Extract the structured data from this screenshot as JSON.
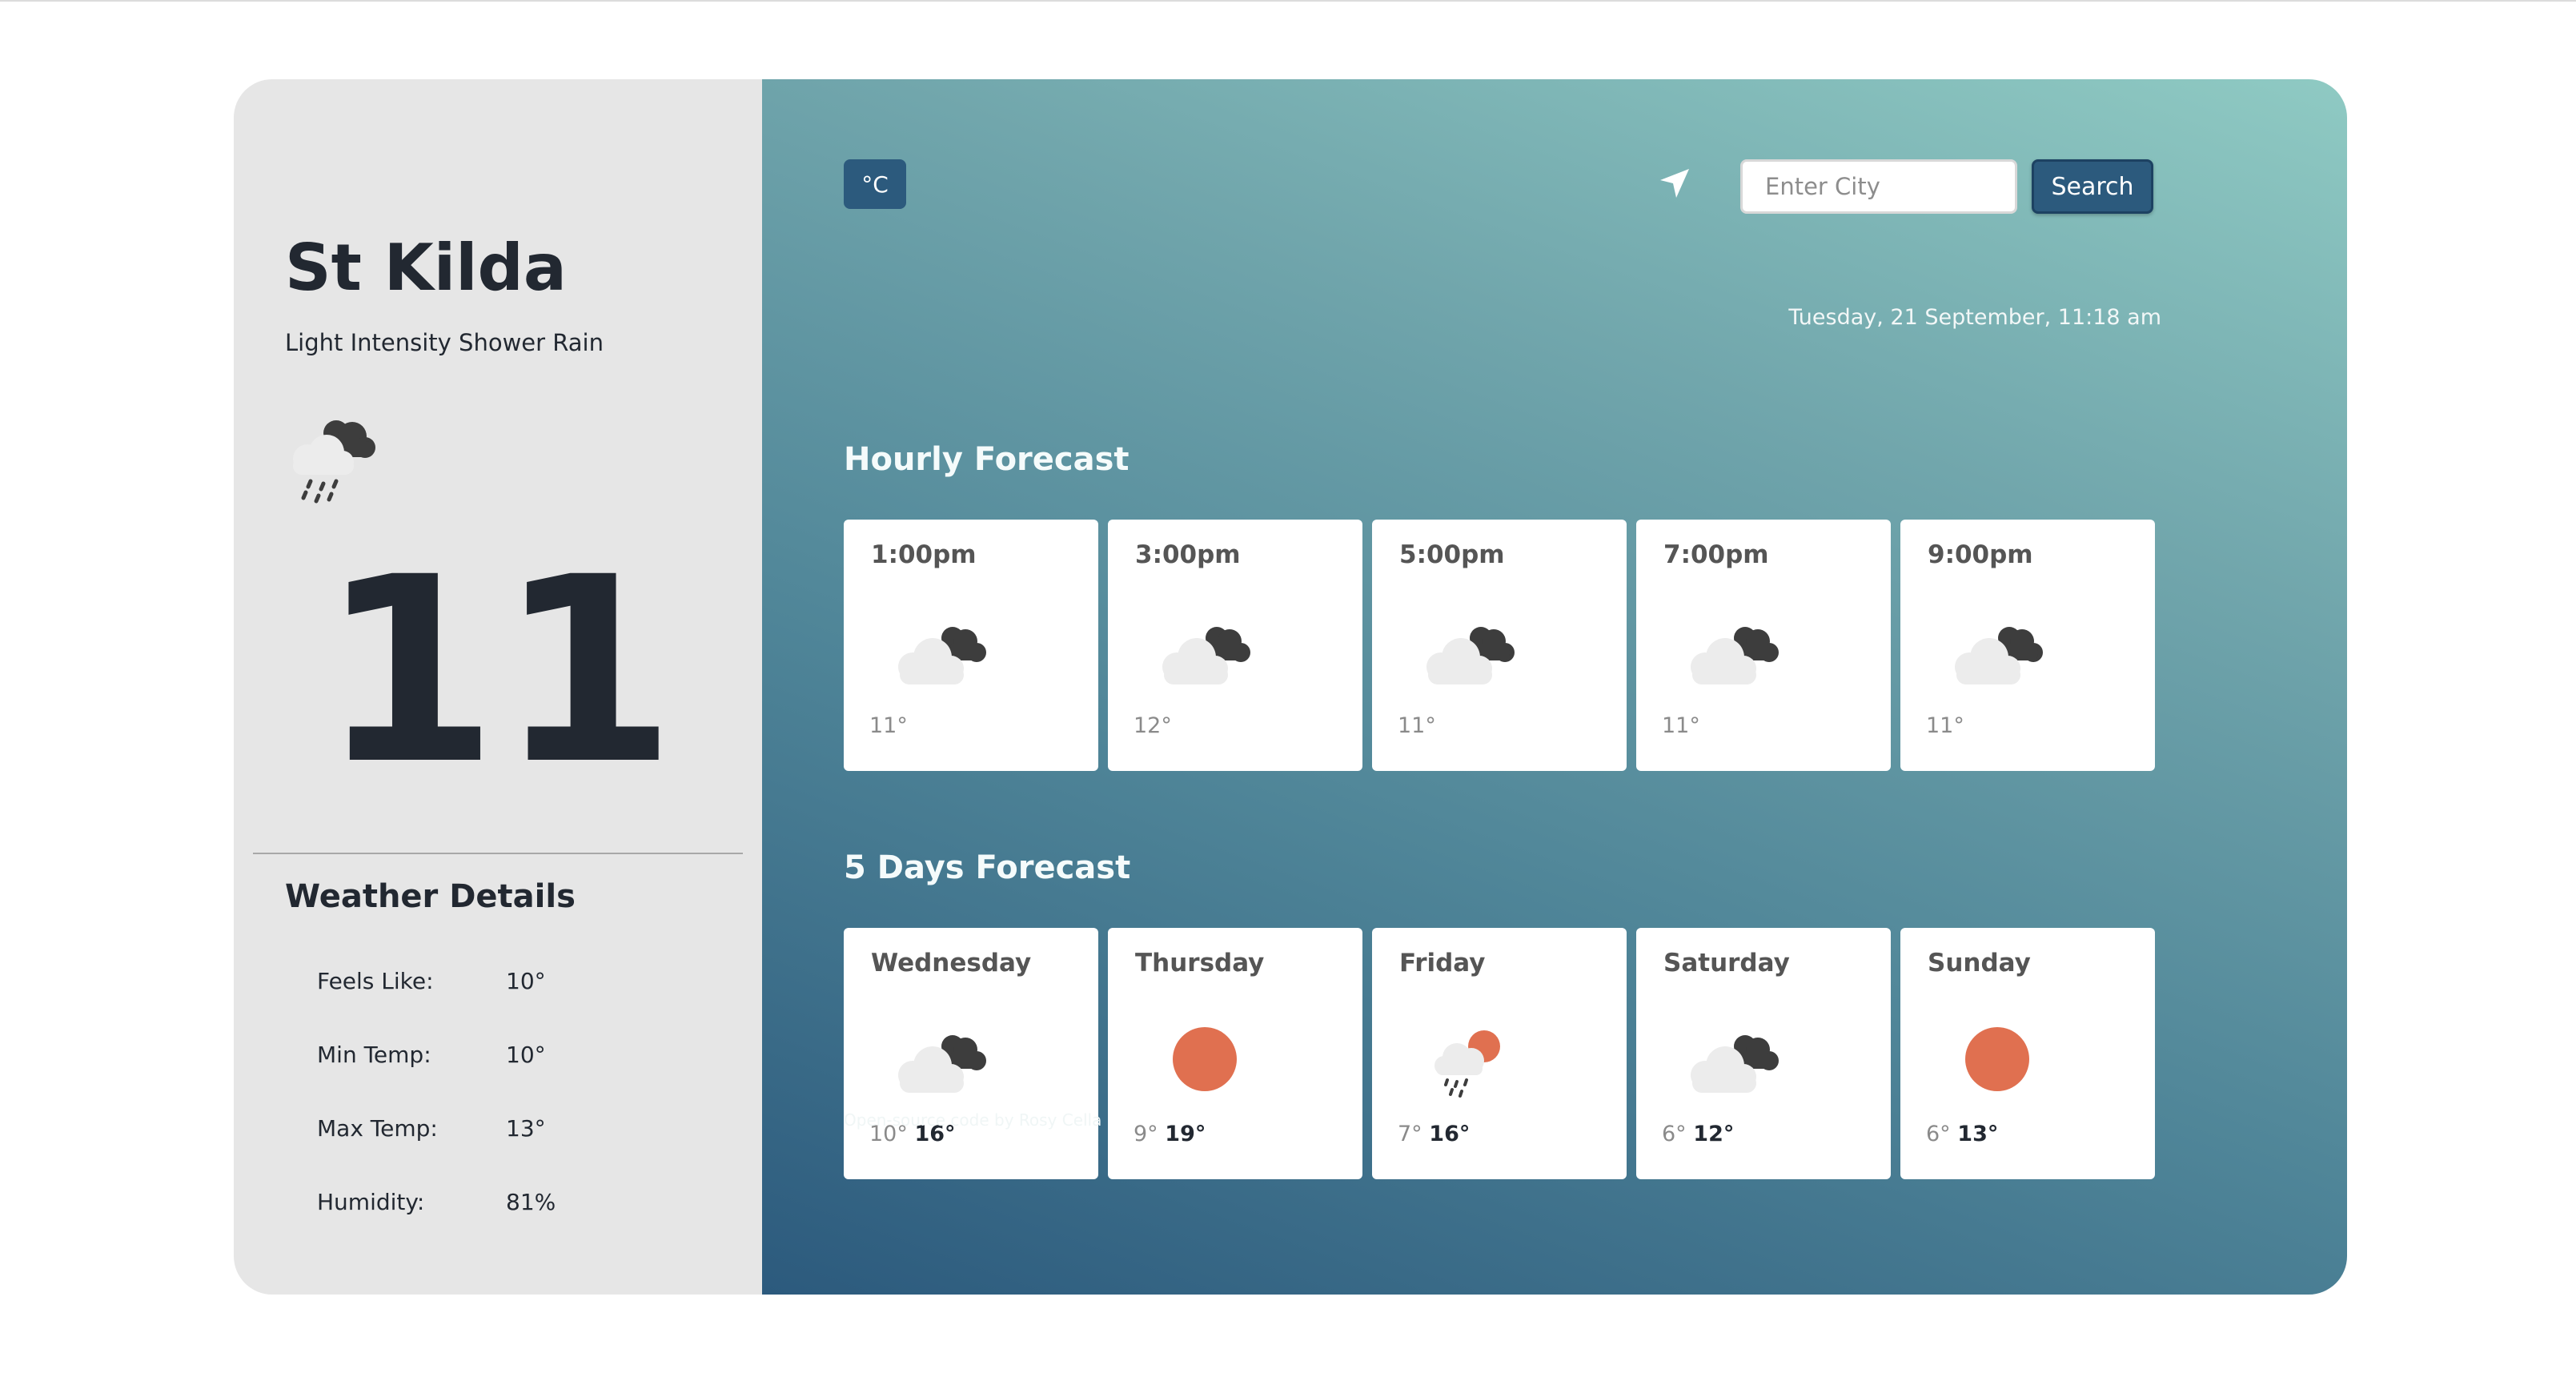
{
  "current": {
    "city": "St Kilda",
    "description": "Light Intensity Shower Rain",
    "icon": "shower-rain-icon",
    "temperature": "11"
  },
  "details": {
    "title": "Weather Details",
    "rows": [
      {
        "label": "Feels Like:",
        "value": "10°"
      },
      {
        "label": "Min Temp:",
        "value": "10°"
      },
      {
        "label": "Max Temp:",
        "value": "13°"
      },
      {
        "label": "Humidity:",
        "value": "81%"
      }
    ]
  },
  "toolbar": {
    "unit_label": "°C",
    "location_icon": "location-arrow-icon",
    "search_placeholder": "Enter City",
    "search_label": "Search",
    "datetime": "Tuesday, 21 September, 11:18 am"
  },
  "hourly": {
    "title": "Hourly Forecast",
    "items": [
      {
        "time": "1:00pm",
        "icon": "broken-clouds-icon",
        "temp": "11°"
      },
      {
        "time": "3:00pm",
        "icon": "broken-clouds-icon",
        "temp": "12°"
      },
      {
        "time": "5:00pm",
        "icon": "broken-clouds-icon",
        "temp": "11°"
      },
      {
        "time": "7:00pm",
        "icon": "broken-clouds-icon",
        "temp": "11°"
      },
      {
        "time": "9:00pm",
        "icon": "broken-clouds-icon",
        "temp": "11°"
      }
    ]
  },
  "daily": {
    "title": "5 Days Forecast",
    "items": [
      {
        "day": "Wednesday",
        "icon": "broken-clouds-icon",
        "min": "10°",
        "max": "16°"
      },
      {
        "day": "Thursday",
        "icon": "clear-sun-icon",
        "min": "9°",
        "max": "19°"
      },
      {
        "day": "Friday",
        "icon": "sun-rain-icon",
        "min": "7°",
        "max": "16°"
      },
      {
        "day": "Saturday",
        "icon": "broken-clouds-icon",
        "min": "6°",
        "max": "12°"
      },
      {
        "day": "Sunday",
        "icon": "clear-sun-icon",
        "min": "6°",
        "max": "13°"
      }
    ]
  },
  "footer": "Open-source code by Rosy Cella",
  "colors": {
    "accent": "#2c5a7d",
    "sun": "#e07050",
    "panel": "#e6e6e6",
    "text_dark": "#222831"
  }
}
